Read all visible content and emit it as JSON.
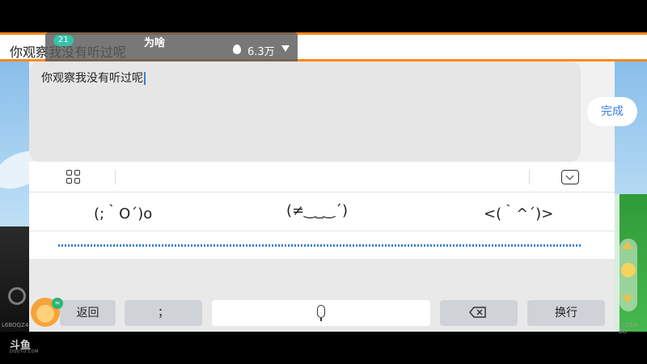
{
  "top_bar": {
    "input_text": "你观察我没有听过呢"
  },
  "room_badge": {
    "level": "21",
    "name": "",
    "message": "为啥",
    "heat": "6.3万"
  },
  "editor": {
    "text": "你观察我没有听过呢",
    "done_label": "完成"
  },
  "toolbar": {
    "left_icon": "grid-icon",
    "right_icon": "keyboard-collapse-icon"
  },
  "emoticons": [
    "(;｀O´)o",
    "(≠‿_‿´)",
    "<(｀^´)>"
  ],
  "keys": {
    "back_label": "返回",
    "semicolon_label": "；",
    "space_icon": "microphone-icon",
    "delete_icon": "backspace-icon",
    "newline_label": "换行"
  },
  "watermark": {
    "logo_text": "斗鱼",
    "domain_text": "DOUYU.COM"
  },
  "side_labels": {
    "left": "L6BOQZ4",
    "right": "- (2)L6 BO"
  },
  "colors": {
    "accent_orange": "#ff8a1e",
    "link_blue": "#3b7ddd",
    "badge_green": "#34c2a8"
  }
}
